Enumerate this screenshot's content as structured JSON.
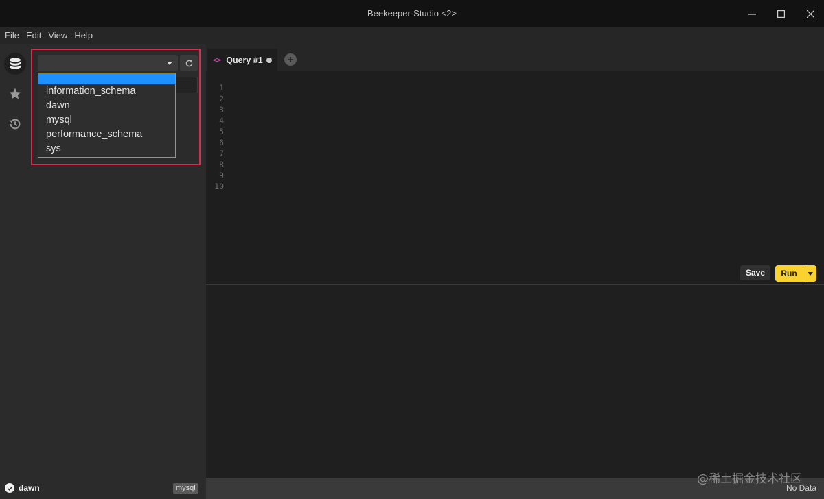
{
  "window": {
    "title": "Beekeeper-Studio <2>",
    "controls": [
      "minimize-icon",
      "maximize-icon",
      "close-icon"
    ]
  },
  "menu": {
    "items": [
      "File",
      "Edit",
      "View",
      "Help"
    ]
  },
  "activity_bar": {
    "icons": [
      "database-icon",
      "star-icon",
      "history-icon"
    ]
  },
  "sidebar": {
    "database_select": {
      "selected": ""
    },
    "filter": {
      "value": "",
      "placeholder": ""
    },
    "dropdown": {
      "options": [
        "",
        "information_schema",
        "dawn",
        "mysql",
        "performance_schema",
        "sys"
      ],
      "selected_index": 0
    }
  },
  "tabs": {
    "items": [
      {
        "label": "Query #1",
        "unsaved": true
      }
    ],
    "add_icon": "plus-icon"
  },
  "editor": {
    "line_numbers": [
      "1",
      "2",
      "3",
      "4",
      "5",
      "6",
      "7",
      "8",
      "9",
      "10"
    ],
    "content": ""
  },
  "actions": {
    "save_label": "Save",
    "run_label": "Run"
  },
  "status": {
    "connection_name": "dawn",
    "connection_type": "mysql",
    "result_text": "No Data",
    "watermark": "@稀土掘金技术社区"
  },
  "colors": {
    "accent": "#f9d230",
    "selection": "#1e90ff",
    "highlight": "#e02a4e",
    "tab_icon": "#d946b8"
  }
}
